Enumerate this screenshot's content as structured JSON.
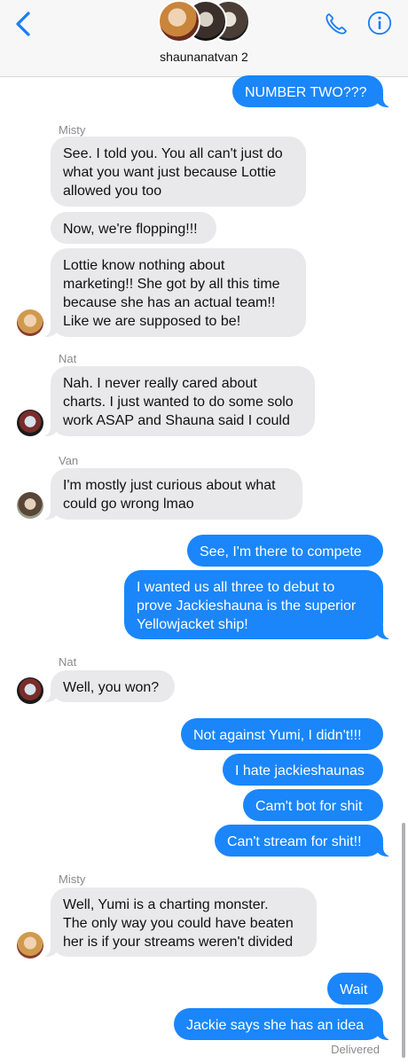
{
  "header": {
    "group_name": "shaunanatvan 2"
  },
  "messages": {
    "m0": "NUMBER TWO???",
    "m1": "See. I told you. You all can't just do\nwhat you want just because Lottie\nallowed you too",
    "m2": "Now, we're flopping!!!",
    "m3": "Lottie know nothing about\nmarketing!! She got by all this time\nbecause she has an actual team!!\nLike we are supposed to be!",
    "m4": "Nah. I never really cared about\ncharts. I just wanted to do some solo\nwork ASAP and Shauna said I could",
    "m5": "I'm mostly just curious about what\ncould go wrong lmao",
    "m6": "See, I'm there to compete",
    "m7": "I wanted us all three to debut to\nprove Jackieshauna is the superior\nYellowjacket ship!",
    "m8": "Well, you won?",
    "m9": "Not against Yumi, I didn't!!!",
    "m10": "I hate jackieshaunas",
    "m11": "Cam't bot for shit",
    "m12": "Can't stream for shit!!",
    "m13": "Well, Yumi is a charting monster.\nThe only way you could have beaten\nher is if your streams weren't divided",
    "m14": "Wait",
    "m15": "Jackie says she has an idea"
  },
  "senders": {
    "s1": "Misty",
    "s2": "Nat",
    "s3": "Van",
    "s4": "Nat",
    "s5": "Misty"
  },
  "status": {
    "delivered": "Delivered"
  },
  "icons": {
    "back": "back-chevron-icon",
    "phone": "phone-icon",
    "info": "info-icon"
  },
  "colors": {
    "outgoing_bubble": "#1a86fa",
    "incoming_bubble": "#e9e9eb",
    "accent": "#1a7cf5"
  }
}
